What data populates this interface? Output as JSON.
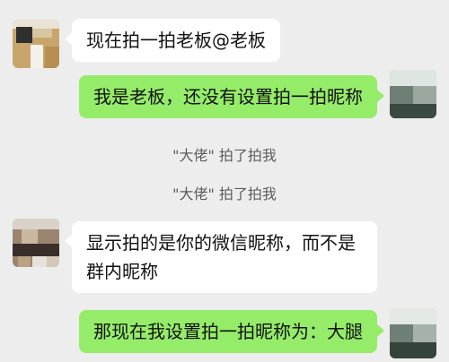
{
  "messages": [
    {
      "side": "left",
      "text": "现在拍一拍老板@老板"
    },
    {
      "side": "right",
      "text": "我是老板，还没有设置拍一拍昵称"
    },
    {
      "side": "system",
      "text": "\"大佬\" 拍了拍我"
    },
    {
      "side": "system",
      "text": "\"大佬\" 拍了拍我"
    },
    {
      "side": "left",
      "lines": [
        "显示拍的是你的微信昵称，而不是",
        "群内昵称"
      ]
    },
    {
      "side": "right",
      "text": "那现在我设置拍一拍昵称为：大腿"
    }
  ],
  "colors": {
    "background": "#ededed",
    "bubble_left": "#ffffff",
    "bubble_right": "#95ec69",
    "text": "#111111",
    "system_text": "#5c5c5c"
  }
}
